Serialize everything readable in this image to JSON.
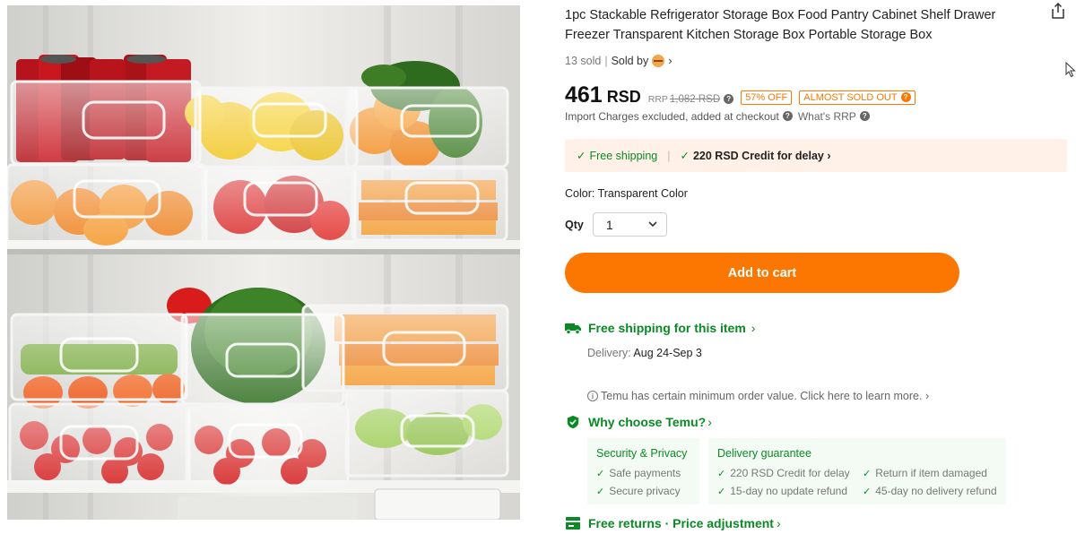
{
  "product": {
    "title": "1pc Stackable Refrigerator Storage Box Food Pantry Cabinet Shelf Drawer Freezer Transparent Kitchen Storage Box Portable Storage Box",
    "sold": "13 sold",
    "sold_by": "Sold by",
    "price": "461",
    "currency": "RSD",
    "rrp_label": "RRP",
    "rrp_value": "1,082 RSD",
    "discount_badge": "57% OFF",
    "stock_badge": "ALMOST SOLD OUT",
    "import_note": "Import Charges excluded, added at checkout",
    "what_rrp": "What's RRP"
  },
  "shipping_banner": {
    "free_shipping": "Free shipping",
    "credit": "220 RSD Credit for delay"
  },
  "options": {
    "color_label": "Color: Transparent Color",
    "qty_label": "Qty",
    "qty_value": "1"
  },
  "cart_button": "Add to cart",
  "shipping_info": {
    "title": "Free shipping for this item",
    "delivery_label": "Delivery:",
    "delivery_dates": "Aug 24-Sep 3",
    "min_order": "Temu has certain minimum order value. Click here to learn more."
  },
  "why": {
    "title": "Why choose Temu?",
    "security": {
      "heading": "Security & Privacy",
      "items": [
        "Safe payments",
        "Secure privacy"
      ]
    },
    "delivery": {
      "heading": "Delivery guarantee",
      "items": [
        "220 RSD Credit for delay",
        "Return if item damaged",
        "15-day no update refund",
        "45-day no delivery refund"
      ]
    }
  },
  "returns": "Free returns · Price adjustment",
  "colors": {
    "accent": "#fb7701",
    "green": "#0a8a24",
    "banner_bg": "#fff1e8",
    "why_bg": "#f4fbf5"
  },
  "icons": [
    "share-icon",
    "truck-icon",
    "shield-icon",
    "returns-icon",
    "info-icon",
    "check-icon",
    "chevron-right-icon",
    "chevron-down-icon",
    "cursor-icon",
    "question-icon"
  ]
}
